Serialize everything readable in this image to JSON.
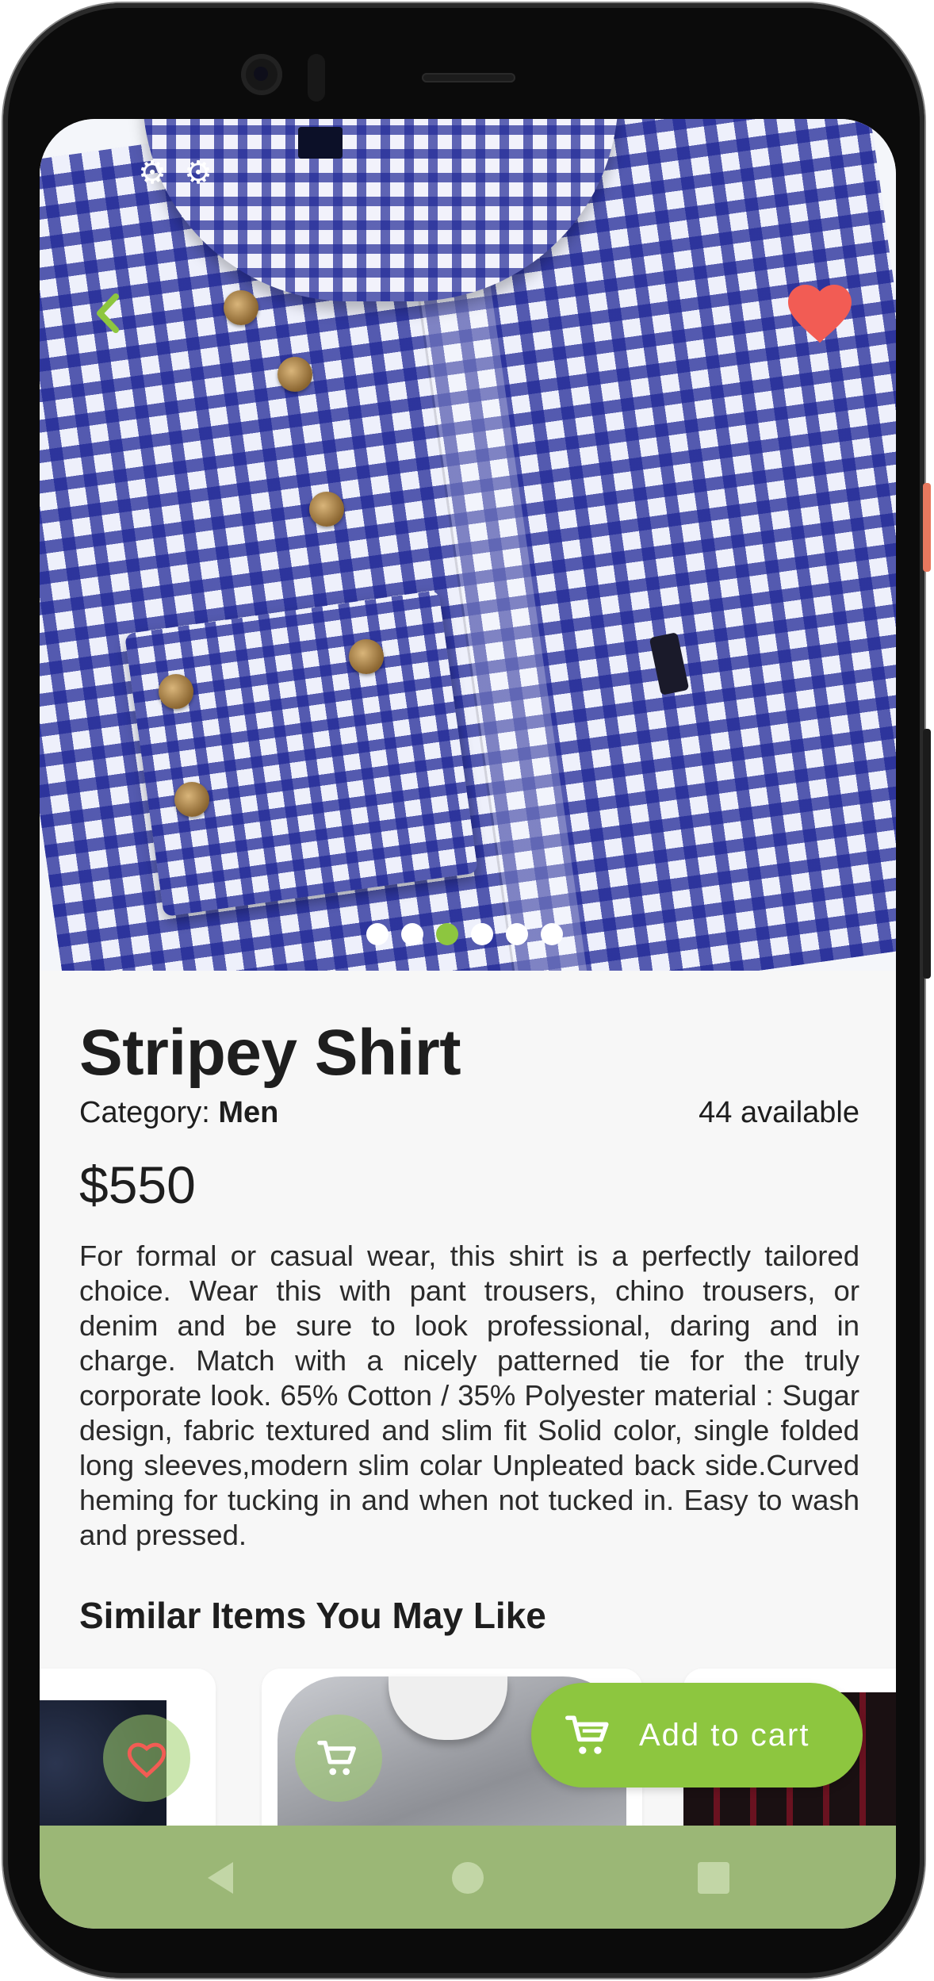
{
  "product": {
    "title": "Stripey Shirt",
    "category_label": "Category: ",
    "category_value": "Men",
    "availability": "44 available",
    "price": "$550",
    "description": "For formal or casual wear, this shirt is a perfectly tailored choice. Wear this with pant trousers, chino trousers, or denim and be sure to look professional, daring and in charge. Match with a nicely patterned tie for the truly corporate look.  65% Cotton / 35% Polyester  material : Sugar design, fabric textured and slim fit  Solid color, single folded long sleeves,modern slim colar  Unpleated back side.Curved heming for tucking in and when not tucked in.  Easy to wash and pressed.",
    "favorite": true
  },
  "carousel": {
    "page_count": 6,
    "active_index": 2
  },
  "similar": {
    "title": "Similar Items You May Like"
  },
  "actions": {
    "add_to_cart_label": "Add to cart"
  },
  "icons": {
    "back": "chevron-left-icon",
    "favorite": "heart-icon",
    "settings": "gear-icon",
    "cart": "cart-icon",
    "nav_back": "triangle-back-icon",
    "nav_home": "circle-home-icon",
    "nav_recents": "square-recents-icon"
  },
  "colors": {
    "accent": "#8dc63f",
    "favorite": "#f25c54",
    "navbar": "#9bb776"
  }
}
